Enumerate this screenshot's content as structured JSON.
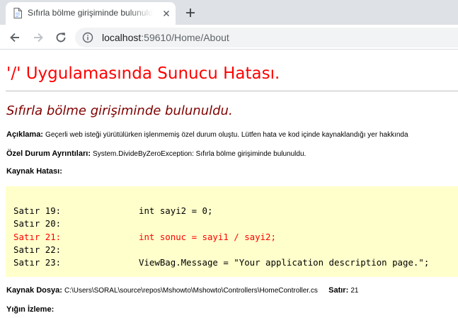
{
  "browser": {
    "tab_title": "Sıfırla bölme girişiminde bulunuldu.",
    "url_host": "localhost",
    "url_rest": ":59610/Home/About"
  },
  "icons": {
    "favicon": "document-icon",
    "tab_close": "close-icon",
    "new_tab": "plus-icon",
    "back": "arrow-left-icon",
    "forward": "arrow-right-icon",
    "reload": "reload-icon",
    "site_info": "info-icon"
  },
  "colors": {
    "error_title": "#ff0000",
    "error_heading": "#800000",
    "code_background": "#ffffcc",
    "code_error_line": "#ff0000"
  },
  "page": {
    "server_error_title": "'/' Uygulamasında Sunucu Hatası.",
    "error_heading": "Sıfırla bölme girişiminde bulunuldu.",
    "description_label": "Açıklama:",
    "description_text": "Geçerli web isteği yürütülürken işlenmemiş özel durum oluştu. Lütfen hata ve kod içinde kaynaklandığı yer hakkında",
    "exception_label": "Özel Durum Ayrıntıları:",
    "exception_text": "System.DivideByZeroException: Sıfırla bölme girişiminde bulunuldu.",
    "source_error_label": "Kaynak Hatası:",
    "code_lines": [
      {
        "line": "Satır 19:",
        "code": "int sayi2 = 0;",
        "error": false
      },
      {
        "line": "Satır 20:",
        "code": "",
        "error": false
      },
      {
        "line": "Satır 21:",
        "code": "int sonuc = sayi1 / sayi2;",
        "error": true
      },
      {
        "line": "Satır 22:",
        "code": "",
        "error": false
      },
      {
        "line": "Satır 23:",
        "code": "ViewBag.Message = \"Your application description page.\";",
        "error": false
      }
    ],
    "source_file_label": "Kaynak Dosya:",
    "source_file_path": "C:\\Users\\SORAL\\source\\repos\\Mshowto\\Mshowto\\Controllers\\HomeController.cs",
    "line_label": "Satır:",
    "line_value": "21",
    "stack_trace_label": "Yığın İzleme:"
  }
}
